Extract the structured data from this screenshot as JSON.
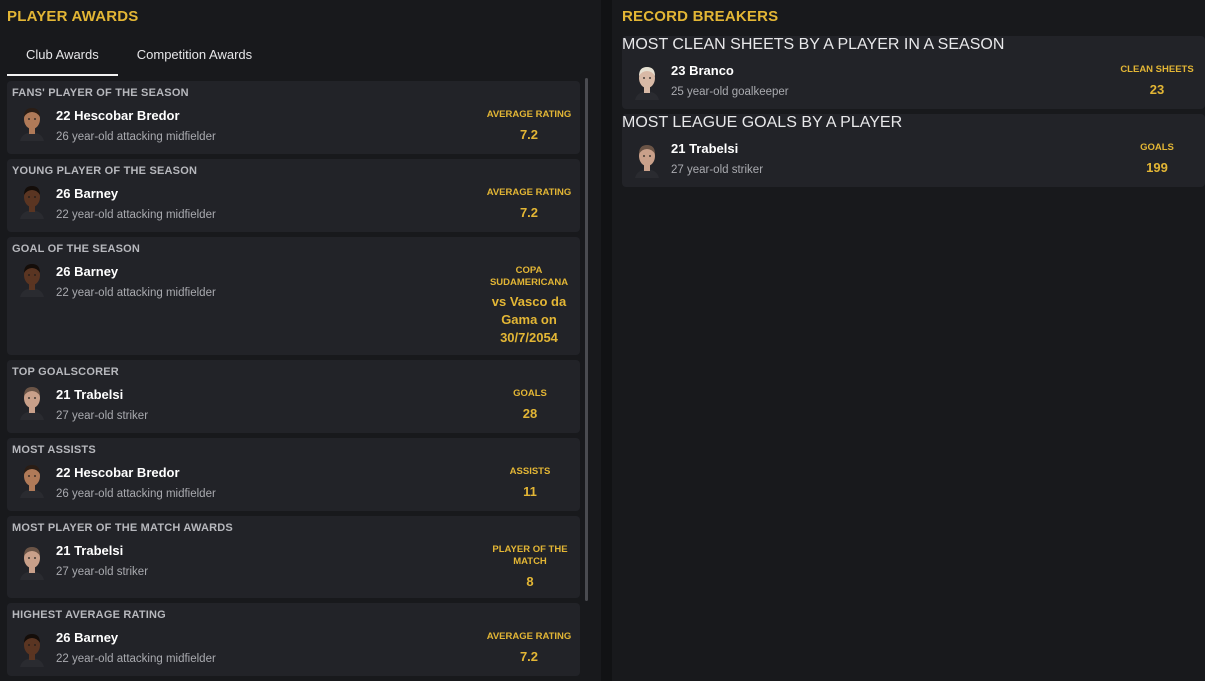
{
  "left": {
    "title": "PLAYER AWARDS",
    "tabs": [
      "Club Awards",
      "Competition Awards"
    ],
    "awards": [
      {
        "category": "FANS' PLAYER OF THE SEASON",
        "player": "22 Hescobar Bredor",
        "desc": "26 year-old attacking midfielder",
        "stat_label": "AVERAGE RATING",
        "stat_value": "7.2",
        "skin": "#b07a58",
        "hair": "#2a1d15"
      },
      {
        "category": "YOUNG PLAYER OF THE SEASON",
        "player": "26 Barney",
        "desc": "22 year-old attacking midfielder",
        "stat_label": "AVERAGE RATING",
        "stat_value": "7.2",
        "skin": "#5a3522",
        "hair": "#140d09"
      },
      {
        "category": "GOAL OF THE SEASON",
        "player": "26 Barney",
        "desc": "22 year-old attacking midfielder",
        "stat_label": "COPA SUDAMERICANA",
        "stat_value": "vs Vasco da Gama on 30/7/2054",
        "skin": "#5a3522",
        "hair": "#140d09"
      },
      {
        "category": "TOP GOALSCORER",
        "player": "21 Trabelsi",
        "desc": "27 year-old striker",
        "stat_label": "GOALS",
        "stat_value": "28",
        "skin": "#c9a08a",
        "hair": "#6b5446"
      },
      {
        "category": "MOST ASSISTS",
        "player": "22 Hescobar Bredor",
        "desc": "26 year-old attacking midfielder",
        "stat_label": "ASSISTS",
        "stat_value": "11",
        "skin": "#b07a58",
        "hair": "#2a1d15"
      },
      {
        "category": "MOST PLAYER OF THE MATCH AWARDS",
        "player": "21 Trabelsi",
        "desc": "27 year-old striker",
        "stat_label": "PLAYER OF THE MATCH",
        "stat_value": "8",
        "skin": "#c9a08a",
        "hair": "#6b5446"
      },
      {
        "category": "HIGHEST AVERAGE RATING",
        "player": "26 Barney",
        "desc": "22 year-old attacking midfielder",
        "stat_label": "AVERAGE RATING",
        "stat_value": "7.2",
        "skin": "#5a3522",
        "hair": "#140d09"
      }
    ]
  },
  "right": {
    "title": "RECORD BREAKERS",
    "records": [
      {
        "category": "MOST CLEAN SHEETS BY A PLAYER IN A SEASON",
        "player": "23 Branco",
        "desc": "25 year-old goalkeeper",
        "stat_label": "CLEAN SHEETS",
        "stat_value": "23",
        "skin": "#d8b9a6",
        "hair": "#e6e0d2"
      },
      {
        "category": "MOST LEAGUE GOALS BY A PLAYER",
        "player": "21 Trabelsi",
        "desc": "27 year-old striker",
        "stat_label": "GOALS",
        "stat_value": "199",
        "skin": "#c9a08a",
        "hair": "#6b5446"
      }
    ]
  }
}
